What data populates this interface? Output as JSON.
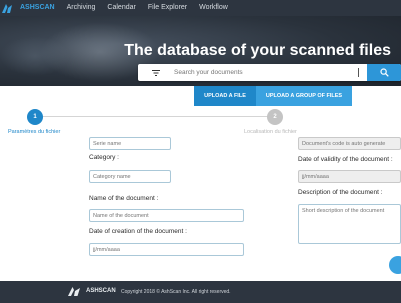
{
  "nav": {
    "items": [
      "ASHSCAN",
      "Archiving",
      "Calendar",
      "File Explorer",
      "Workflow"
    ]
  },
  "hero": {
    "title": "The database of your scanned files"
  },
  "search": {
    "placeholder": "Search your documents",
    "filter_icon": "filter-icon",
    "user_icon": "user-icon",
    "search_icon": "search-icon"
  },
  "upload_tabs": [
    {
      "label": "UPLOAD A FILE",
      "active": true
    },
    {
      "label": "UPLOAD A GROUP OF FILES",
      "active": false
    }
  ],
  "stepper": {
    "steps": [
      {
        "number": "1",
        "label": "Paramètres du fichier",
        "active": true
      },
      {
        "number": "2",
        "label": "Localisation du fichier",
        "active": false
      }
    ]
  },
  "form": {
    "serie_placeholder": "Serie name",
    "category_label": "Category :",
    "category_placeholder": "Category name",
    "name_label": "Name of the document :",
    "name_placeholder": "Name of the document",
    "creation_label": "Date of creation of the document :",
    "creation_placeholder": "jj/mm/aaaa",
    "code_placeholder": "Document's code is auto generate",
    "validity_label": "Date of validity of the document :",
    "validity_placeholder": "jj/mm/aaaa",
    "description_label": "Description of the document :",
    "description_placeholder": "Short description of the document"
  },
  "footer": {
    "brand": "ASHSCAN",
    "copyright": "Copyright 2018 © AshScan Inc. All right reserved."
  },
  "colors": {
    "accent": "#1f87c9",
    "accent_light": "#3aa2e0",
    "nav_bg": "#2d3540"
  }
}
